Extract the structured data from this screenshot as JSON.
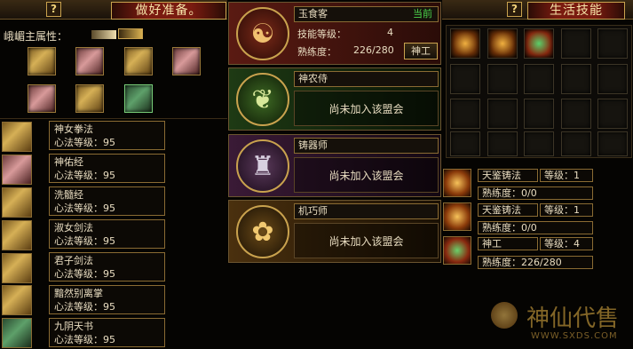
{
  "left": {
    "help": "?",
    "banner": "做好准备。",
    "attr_label": "峨嵋主属性：",
    "skills": [
      {
        "name": "神女拳法",
        "level": "心法等级：95"
      },
      {
        "name": "神佑经",
        "level": "心法等级：95"
      },
      {
        "name": "洗髓经",
        "level": "心法等级：95"
      },
      {
        "name": "淑女剑法",
        "level": "心法等级：95"
      },
      {
        "name": "君子剑法",
        "level": "心法等级：95"
      },
      {
        "name": "黯然别离掌",
        "level": "心法等级：95"
      },
      {
        "name": "九阴天书",
        "level": "心法等级：95"
      }
    ]
  },
  "middle": {
    "professions": [
      {
        "name": "玉食客",
        "status": "当前",
        "skill_level_label": "技能等级：",
        "skill_level_value": "4",
        "proficiency_label": "熟练度：",
        "proficiency_value": "226/280",
        "button": "神工"
      },
      {
        "name": "神农侍",
        "message": "尚未加入该盟会"
      },
      {
        "name": "铸器师",
        "message": "尚未加入该盟会"
      },
      {
        "name": "机巧师",
        "message": "尚未加入该盟会"
      }
    ]
  },
  "right": {
    "help": "?",
    "banner": "生活技能",
    "entries": [
      {
        "name": "天鉴铸法",
        "level": "等级：1",
        "proficiency": "熟练度：0/0"
      },
      {
        "name": "天鉴铸法",
        "level": "等级：1",
        "proficiency": "熟练度：0/0"
      },
      {
        "name": "神工",
        "level": "等级：4",
        "proficiency": "熟练度：226/280"
      }
    ]
  },
  "watermark": {
    "brand": "神仙代售",
    "url": "WWW.SXDS.COM"
  },
  "colors": {
    "gold": "#f1d58b",
    "green": "#4cd64c",
    "border": "#8a6b33"
  }
}
